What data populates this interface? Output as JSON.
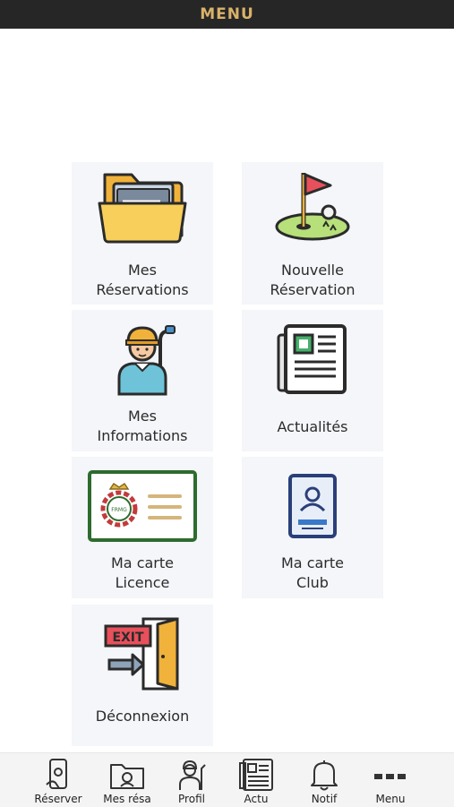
{
  "header": {
    "title": "MENU"
  },
  "tiles": [
    {
      "icon": "folder-icon",
      "label": "Mes\nRéservations"
    },
    {
      "icon": "golf-flag-icon",
      "label": "Nouvelle\nRéservation"
    },
    {
      "icon": "golfer-icon",
      "label": "Mes\nInformations"
    },
    {
      "icon": "newspaper-icon",
      "label": "Actualités"
    },
    {
      "icon": "license-card-icon",
      "label": "Ma carte\nLicence",
      "card_emblem_text": "FRMG"
    },
    {
      "icon": "id-badge-icon",
      "label": "Ma carte\nClub"
    },
    {
      "icon": "exit-door-icon",
      "label": "Déconnexion",
      "sign_text": "EXIT"
    }
  ],
  "tabbar": [
    {
      "icon": "phone-reserve-icon",
      "label": "Réserver"
    },
    {
      "icon": "folder-user-icon",
      "label": "Mes résa"
    },
    {
      "icon": "golfer-profile-icon",
      "label": "Profil"
    },
    {
      "icon": "newspaper-tab-icon",
      "label": "Actu"
    },
    {
      "icon": "bell-icon",
      "label": "Notif"
    },
    {
      "icon": "more-dots-icon",
      "label": "Menu"
    }
  ],
  "colors": {
    "header_bg": "#262626",
    "header_text": "#d9b26a",
    "tile_bg": "#f4f6f9",
    "tabbar_bg": "#f4f4f4"
  }
}
